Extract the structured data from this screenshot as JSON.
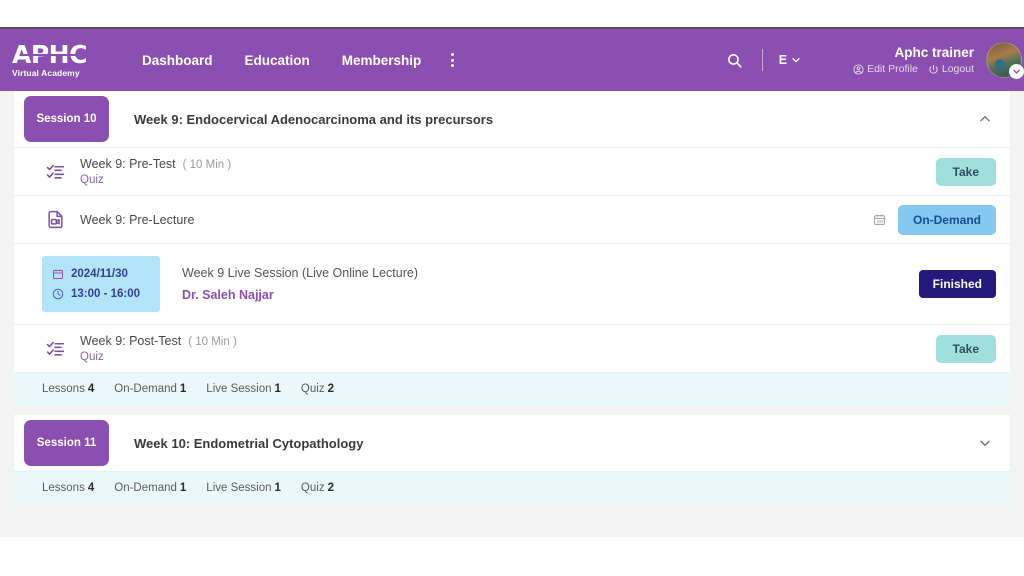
{
  "header": {
    "brand": {
      "mark": "APHC",
      "sub": "Virtual Academy"
    },
    "nav": [
      {
        "label": "Dashboard"
      },
      {
        "label": "Education"
      },
      {
        "label": "Membership"
      }
    ],
    "kebab_icon": "more-vertical-icon",
    "search_icon": "search-icon",
    "language": {
      "label": "E",
      "chevron": "chevron-down-icon"
    },
    "user": {
      "name": "Aphc trainer",
      "edit_profile": "Edit Profile",
      "logout": "Logout",
      "avatar": "user-avatar",
      "avatar_badge": "chevron-down-icon"
    }
  },
  "colors": {
    "brand_purple": "#8a4fb0",
    "take_button": "#9fe0dd",
    "ondemand_button": "#85c8f0",
    "finished_badge": "#23197a",
    "date_box": "#b3e5fa",
    "stats_bar": "#eaf8fa",
    "page_bg": "#f3f3f3"
  },
  "sessions": [
    {
      "badge": "Session 10",
      "title": "Week 9: Endocervical Adenocarcinoma and its precursors",
      "expanded": true,
      "toggle_icon": "chevron-up-icon",
      "lessons": [
        {
          "kind": "quiz",
          "icon": "checklist-icon",
          "title": "Week 9: Pre-Test",
          "duration": "( 10 Min )",
          "type": "Quiz",
          "action": "Take"
        },
        {
          "kind": "ondemand",
          "icon": "video-file-icon",
          "title": "Week 9: Pre-Lecture",
          "duration": "",
          "type": "",
          "side_icon": "calendar-icon",
          "action": "On-Demand"
        },
        {
          "kind": "live",
          "date": "2024/11/30",
          "time": "13:00 - 16:00",
          "date_icon": "calendar-icon",
          "time_icon": "clock-icon",
          "title": "Week 9 Live Session (Live Online Lecture)",
          "instructor": "Dr. Saleh Najjar",
          "action": "Finished"
        },
        {
          "kind": "quiz",
          "icon": "checklist-icon",
          "title": "Week 9: Post-Test",
          "duration": "( 10 Min )",
          "type": "Quiz",
          "action": "Take"
        }
      ],
      "stats": [
        {
          "label": "Lessons",
          "value": "4"
        },
        {
          "label": "On-Demand",
          "value": "1"
        },
        {
          "label": "Live Session",
          "value": "1"
        },
        {
          "label": "Quiz",
          "value": "2"
        }
      ]
    },
    {
      "badge": "Session 11",
      "title": "Week 10: Endometrial Cytopathology",
      "expanded": false,
      "toggle_icon": "chevron-down-icon",
      "lessons": [],
      "stats": [
        {
          "label": "Lessons",
          "value": "4"
        },
        {
          "label": "On-Demand",
          "value": "1"
        },
        {
          "label": "Live Session",
          "value": "1"
        },
        {
          "label": "Quiz",
          "value": "2"
        }
      ]
    }
  ]
}
